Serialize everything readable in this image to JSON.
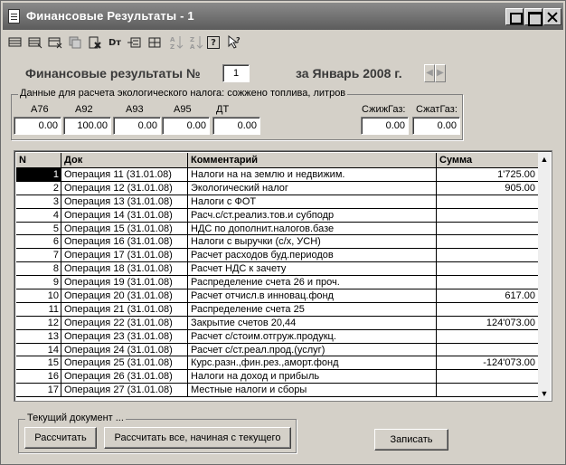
{
  "window": {
    "title": "Финансовые Результаты - 1"
  },
  "toolbar": {
    "icons": [
      "new-row-icon",
      "copy-row-icon",
      "delete-row-icon",
      "copy-icon",
      "delete-doc-icon",
      "dt-icon",
      "insert-icon",
      "grid-icon",
      "sort-asc-icon",
      "sort-desc-icon",
      "help-icon",
      "pointer-help-icon"
    ],
    "dt_label": "Dт",
    "help_label": "?"
  },
  "header": {
    "title_label": "Финансовые результаты №",
    "number": "1",
    "period_label": "за Январь 2008 г."
  },
  "fuel_group": {
    "legend": "Данные для расчета экологического налога: сожжено топлива, литров",
    "fields": [
      {
        "label": "А76",
        "value": "0.00"
      },
      {
        "label": "А92",
        "value": "100.00"
      },
      {
        "label": "А93",
        "value": "0.00"
      },
      {
        "label": "А95",
        "value": "0.00"
      },
      {
        "label": "ДТ",
        "value": "0.00"
      },
      {
        "label": "СжижГаз:",
        "value": "0.00"
      },
      {
        "label": "СжатГаз:",
        "value": "0.00"
      }
    ]
  },
  "grid": {
    "columns": [
      "N",
      "Док",
      "Комментарий",
      "Сумма"
    ],
    "rows": [
      {
        "n": "1",
        "doc": "Операция 11 (31.01.08)",
        "comment": "Налоги на на землю и недвижим.",
        "sum": "1'725.00"
      },
      {
        "n": "2",
        "doc": "Операция 12 (31.01.08)",
        "comment": "Экологический налог",
        "sum": "905.00"
      },
      {
        "n": "3",
        "doc": "Операция 13 (31.01.08)",
        "comment": "Налоги с ФОТ",
        "sum": ""
      },
      {
        "n": "4",
        "doc": "Операция 14 (31.01.08)",
        "comment": "Расч.с/ст.реализ.тов.и субподр",
        "sum": ""
      },
      {
        "n": "5",
        "doc": "Операция 15 (31.01.08)",
        "comment": "НДС по дополнит.налогов.базе",
        "sum": ""
      },
      {
        "n": "6",
        "doc": "Операция 16 (31.01.08)",
        "comment": "Налоги с выручки (с/х, УСН)",
        "sum": ""
      },
      {
        "n": "7",
        "doc": "Операция 17 (31.01.08)",
        "comment": "Расчет расходов буд.периодов",
        "sum": ""
      },
      {
        "n": "8",
        "doc": "Операция 18 (31.01.08)",
        "comment": "Расчет НДС к зачету",
        "sum": ""
      },
      {
        "n": "9",
        "doc": "Операция 19 (31.01.08)",
        "comment": "Распределение счета 26 и проч.",
        "sum": ""
      },
      {
        "n": "10",
        "doc": "Операция 20 (31.01.08)",
        "comment": "Расчет отчисл.в инновац.фонд",
        "sum": "617.00"
      },
      {
        "n": "11",
        "doc": "Операция 21 (31.01.08)",
        "comment": "Распределение счета 25",
        "sum": ""
      },
      {
        "n": "12",
        "doc": "Операция 22 (31.01.08)",
        "comment": "Закрытие счетов 20,44",
        "sum": "124'073.00"
      },
      {
        "n": "13",
        "doc": "Операция 23 (31.01.08)",
        "comment": "Расчет с/стоим.отгруж.продукц.",
        "sum": ""
      },
      {
        "n": "14",
        "doc": "Операция 24 (31.01.08)",
        "comment": "Расчет с/ст.реал.прод.(услуг)",
        "sum": ""
      },
      {
        "n": "15",
        "doc": "Операция 25 (31.01.08)",
        "comment": "Курс.разн.,фин.рез.,аморт.фонд",
        "sum": "-124'073.00"
      },
      {
        "n": "16",
        "doc": "Операция 26 (31.01.08)",
        "comment": "Налоги на доход и прибыль",
        "sum": ""
      },
      {
        "n": "17",
        "doc": "Операция 27 (31.01.08)",
        "comment": "Местные налоги и сборы",
        "sum": ""
      }
    ]
  },
  "current_doc": {
    "legend": "Текущий документ ...",
    "calc_label": "Рассчитать",
    "calc_all_label": "Рассчитать все, начиная с текущего"
  },
  "save_label": "Записать"
}
